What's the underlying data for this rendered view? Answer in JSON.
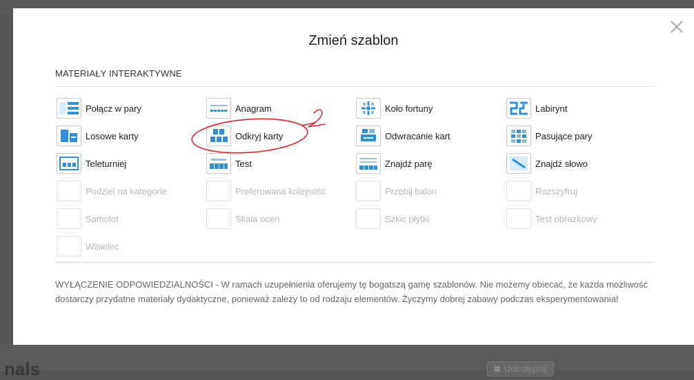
{
  "background": {
    "left_text": "nals",
    "share_label": "Udostępnij"
  },
  "modal": {
    "title": "Zmień szablon",
    "section_title": "MATERIAŁY INTERAKTYWNE",
    "templates": [
      {
        "label": "Połącz w pary",
        "icon": "match-up-icon",
        "enabled": true
      },
      {
        "label": "Anagram",
        "icon": "anagram-icon",
        "enabled": true
      },
      {
        "label": "Koło fortuny",
        "icon": "wheel-icon",
        "enabled": true
      },
      {
        "label": "Labirynt",
        "icon": "maze-icon",
        "enabled": true
      },
      {
        "label": "Losowe karty",
        "icon": "random-cards-icon",
        "enabled": true
      },
      {
        "label": "Odkryj karty",
        "icon": "open-box-icon",
        "enabled": true
      },
      {
        "label": "Odwracanie kart",
        "icon": "flip-tiles-icon",
        "enabled": true
      },
      {
        "label": "Pasujące pary",
        "icon": "matching-pairs-icon",
        "enabled": true
      },
      {
        "label": "Teleturniej",
        "icon": "quiz-show-icon",
        "enabled": true
      },
      {
        "label": "Test",
        "icon": "quiz-icon",
        "enabled": true
      },
      {
        "label": "Znajdź parę",
        "icon": "find-match-icon",
        "enabled": true
      },
      {
        "label": "Znajdź słowo",
        "icon": "wordsearch-icon",
        "enabled": true
      },
      {
        "label": "Podziel na kategorie",
        "icon": "group-sort-icon",
        "enabled": false
      },
      {
        "label": "Preferowana kolejność",
        "icon": "rank-order-icon",
        "enabled": false
      },
      {
        "label": "Przebij balon",
        "icon": "balloon-pop-icon",
        "enabled": false
      },
      {
        "label": "Rozszyfruj",
        "icon": "unjumble-icon",
        "enabled": false
      },
      {
        "label": "Samolot",
        "icon": "airplane-icon",
        "enabled": false
      },
      {
        "label": "Skala ocen",
        "icon": "rating-scale-icon",
        "enabled": false
      },
      {
        "label": "Szkic płytki",
        "icon": "tile-sketch-icon",
        "enabled": false
      },
      {
        "label": "Test obrazkowy",
        "icon": "image-quiz-icon",
        "enabled": false
      },
      {
        "label": "Wisielec",
        "icon": "hangman-icon",
        "enabled": false
      }
    ],
    "disclaimer": "WYŁĄCZENIE ODPOWIEDZIALNOŚCI - W ramach uzupełnienia oferujemy tę bogatszą gamę szablonów. Nie możemy obiecać, że każda możliwość dostarczy przydatne materiały dydaktyczne, ponieważ zależy to od rodzaju elementów. Życzymy dobrej zabawy podczas eksperymentowania!"
  },
  "annotation": {
    "number": "2",
    "color": "#e3212b"
  },
  "colors": {
    "icon_blue": "#2f8fd8",
    "icon_light": "#d7ebfa"
  }
}
